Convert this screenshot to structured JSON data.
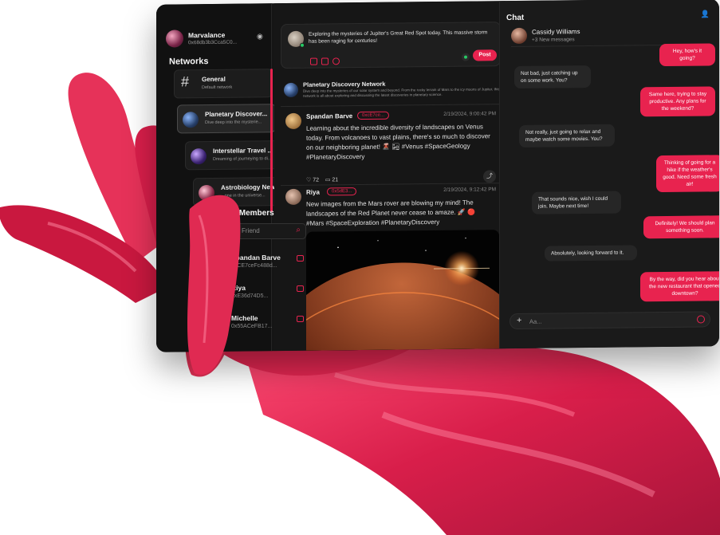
{
  "profile": {
    "name": "Marvalance",
    "address": "0x68db3b3Cca5C0..."
  },
  "networks": {
    "title": "Networks",
    "items": [
      {
        "title": "General",
        "subtitle": "Default network"
      },
      {
        "title": "Planetary Discover...",
        "subtitle": "Dive deep into the mysterie..."
      },
      {
        "title": "Interstellar Travel ...",
        "subtitle": "Dreaming of journeying to di..."
      },
      {
        "title": "Astrobiology Netw...",
        "subtitle": "...one in the universe..."
      }
    ]
  },
  "community": {
    "title": "Community Members",
    "search_placeholder": "Friend",
    "members": [
      {
        "name": "Spandan Barve",
        "address": "0xCE7ceFc488d..."
      },
      {
        "name": "Riya",
        "address": "0xE36d74D5..."
      },
      {
        "name": "Michelle",
        "address": "0x55ACeFB17..."
      }
    ]
  },
  "composer": {
    "text": "Exploring the mysteries of Jupiter's Great Red Spot today. This massive storm has been raging for centuries!",
    "post_label": "Post"
  },
  "network_header": {
    "title": "Planetary Discovery Network",
    "description": "Dive deep into the mysteries of our solar system and beyond. From the rocky terrain of Mars to the icy moons of Jupiter, this network is all about exploring and discussing the latest discoveries in planetary science."
  },
  "posts": [
    {
      "author": "Spandan Barve",
      "tag": "0xcE7ce...",
      "time": "2/19/2024, 9:00:42 PM",
      "body": "Learning about the incredible diversity of landscapes on Venus today. From volcanoes to vast plains, there's so much to discover on our neighboring planet! 🌋 🏜 #Venus #SpaceGeology #PlanetaryDiscovery",
      "likes": "72",
      "comments": "21"
    },
    {
      "author": "Riya",
      "tag": "0x5dE3...",
      "time": "2/19/2024, 9:12:42 PM",
      "body": "New images from the Mars rover are blowing my mind! The landscapes of the Red Planet never cease to amaze. 🚀 🔴 #Mars #SpaceExploration #PlanetaryDiscovery"
    }
  ],
  "chat": {
    "title": "Chat",
    "contact": {
      "name": "Cassidy Williams",
      "status": "+3 New messages"
    },
    "messages": [
      {
        "dir": "out",
        "text": "Hey, how's it going?"
      },
      {
        "dir": "in",
        "text": "Not bad, just catching up on some work. You?"
      },
      {
        "dir": "out",
        "text": "Same here, trying to stay productive. Any plans for the weekend?"
      },
      {
        "dir": "in",
        "text": "Not really, just going to relax and maybe watch some movies. You?"
      },
      {
        "dir": "out",
        "text": "Thinking of going for a hike if the weather's good. Need some fresh air!"
      },
      {
        "dir": "in",
        "text": "That sounds nice, wish I could join. Maybe next time!"
      },
      {
        "dir": "out",
        "text": "Definitely! We should plan something soon."
      },
      {
        "dir": "in",
        "text": "Absolutely, looking forward to it."
      },
      {
        "dir": "out",
        "text": "By the way, did you hear about the new restaurant that opened downtown?"
      }
    ],
    "input_placeholder": "Aa..."
  },
  "colors": {
    "accent": "#e8234f",
    "panel": "#151515",
    "hand": "#d81e4a"
  }
}
